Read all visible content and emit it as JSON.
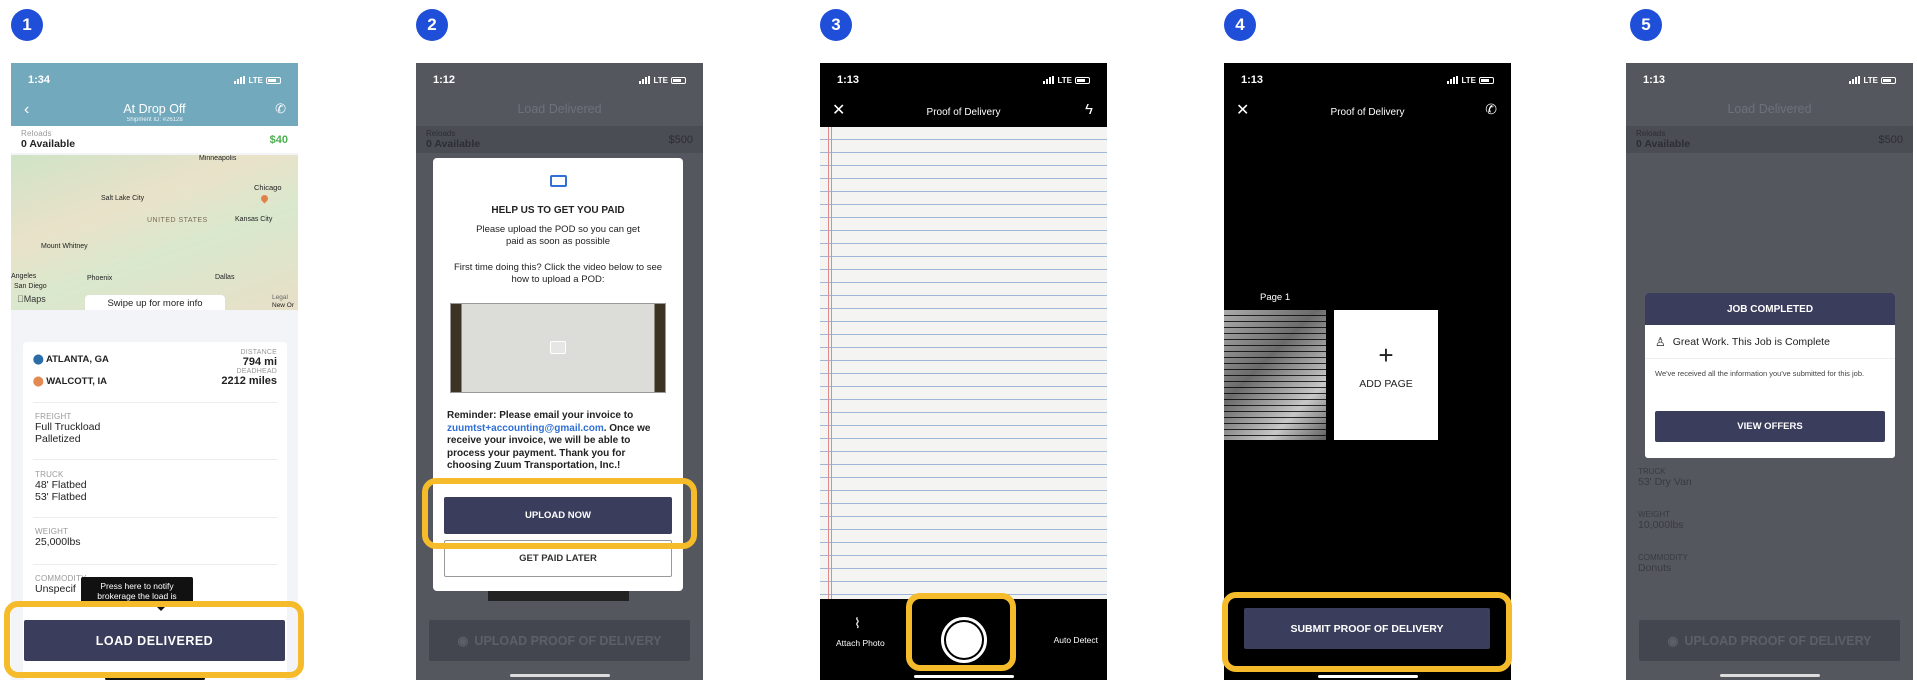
{
  "steps": [
    "1",
    "2",
    "3",
    "4",
    "5"
  ],
  "screen1": {
    "time": "1:34",
    "network": "LTE",
    "title": "At Drop Off",
    "shipment": "Shipment ID: #26128",
    "reloads_label": "Reloads",
    "reloads_value": "0 Available",
    "reloads_amount": "$40",
    "map": {
      "cities": [
        "Salt Lake City",
        "Chicago",
        "UNITED STATES",
        "Kansas City",
        "Mount Whitney",
        "Angeles",
        "San Diego",
        "Phoenix",
        "Dallas",
        "Minneapolis",
        "New Or"
      ],
      "brand": "Maps",
      "legal": "Legal"
    },
    "swipe_hint": "Swipe up for more info",
    "origin": "ATLANTA, GA",
    "destination": "WALCOTT, IA",
    "distance_label": "DISTANCE",
    "distance_value": "794 mi",
    "deadhead_label": "DEADHEAD",
    "deadhead_value": "2212 miles",
    "freight_label": "FREIGHT",
    "freight_values": [
      "Full Truckload",
      "Palletized"
    ],
    "truck_label": "TRUCK",
    "truck_values": [
      "48' Flatbed",
      "53' Flatbed"
    ],
    "weight_label": "WEIGHT",
    "weight_value": "25,000lbs",
    "commodity_label": "COMMODITY",
    "commodity_value": "Unspecif",
    "tooltip": "Press here to notify brokerage the load is delivered",
    "button": "LOAD DELIVERED"
  },
  "screen2": {
    "time": "1:12",
    "network": "LTE",
    "bg_title": "Load Delivered",
    "bg_reloads_label": "Reloads",
    "bg_reloads_value": "0 Available",
    "bg_amount": "$500",
    "modal_title": "HELP US TO GET YOU PAID",
    "modal_sub": "Please upload the POD so you can get paid as soon as possible",
    "modal_first": "First time doing this? Click the video below to see how to upload a POD:",
    "reminder_prefix": "Reminder: Please email your invoice to ",
    "reminder_email": "zuumtst+accounting@gmail.com",
    "reminder_suffix": ". Once we receive your invoice, we will be able to process your payment. Thank you for choosing Zuum Transportation, Inc.!",
    "upload_now": "UPLOAD NOW",
    "get_paid_later": "GET PAID LATER",
    "bottom_button": "UPLOAD PROOF OF DELIVERY"
  },
  "screen3": {
    "time": "1:13",
    "network": "LTE",
    "title": "Proof of Delivery",
    "attach_photo": "Attach Photo",
    "auto_detect": "Auto Detect"
  },
  "screen4": {
    "time": "1:13",
    "network": "LTE",
    "title": "Proof of Delivery",
    "page_label": "Page 1",
    "add_page": "ADD PAGE",
    "submit": "SUBMIT PROOF OF DELIVERY"
  },
  "screen5": {
    "time": "1:13",
    "network": "LTE",
    "bg_title": "Load Delivered",
    "bg_reloads_label": "Reloads",
    "bg_reloads_value": "0 Available",
    "bg_amount": "$500",
    "modal_title": "JOB COMPLETED",
    "great_work": "Great Work. This Job is Complete",
    "received": "We've received all the information you've submitted for this job.",
    "view_offers": "VIEW OFFERS",
    "truck_label": "TRUCK",
    "truck_value": "53' Dry Van",
    "weight_label": "WEIGHT",
    "weight_value": "10,000lbs",
    "commodity_label": "COMMODITY",
    "commodity_value": "Donuts",
    "bottom_button": "UPLOAD PROOF OF DELIVERY"
  },
  "colors": {
    "highlight": "#f5bb2a",
    "step_badge": "#1f4fd8",
    "navy_button": "#3b3d5c",
    "header_teal": "#73a9bd",
    "money_green": "#4caf50",
    "link_blue": "#2f6fd6"
  }
}
